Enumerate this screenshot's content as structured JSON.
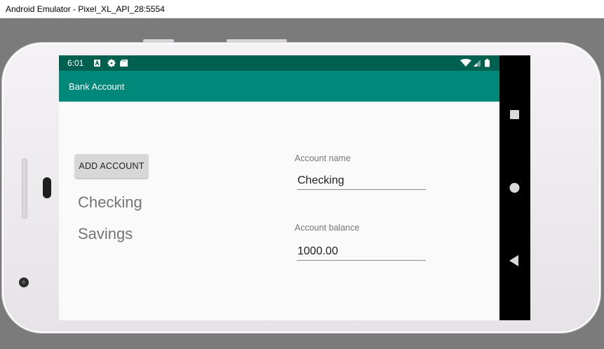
{
  "window": {
    "title": "Android Emulator - Pixel_XL_API_28:5554"
  },
  "status_bar": {
    "time": "6:01",
    "icons": [
      "a-notification-icon",
      "gear-icon",
      "sd-card-icon"
    ],
    "right_icons": [
      "wifi-icon",
      "cell-signal-icon",
      "battery-icon"
    ]
  },
  "app_bar": {
    "title": "Bank Account"
  },
  "main": {
    "add_button_label": "ADD ACCOUNT",
    "accounts": [
      {
        "name": "Checking"
      },
      {
        "name": "Savings"
      }
    ],
    "account_name": {
      "label": "Account name",
      "value": "Checking"
    },
    "account_balance": {
      "label": "Account balance",
      "value": "1000.00"
    }
  },
  "nav_bar": {
    "buttons": [
      "overview-square-icon",
      "home-circle-icon",
      "back-triangle-icon"
    ]
  },
  "colors": {
    "status_bar": "#00604f",
    "app_bar": "#00897b",
    "screen_bg": "#fafafa",
    "emulator_bg": "#7b7b7b"
  }
}
